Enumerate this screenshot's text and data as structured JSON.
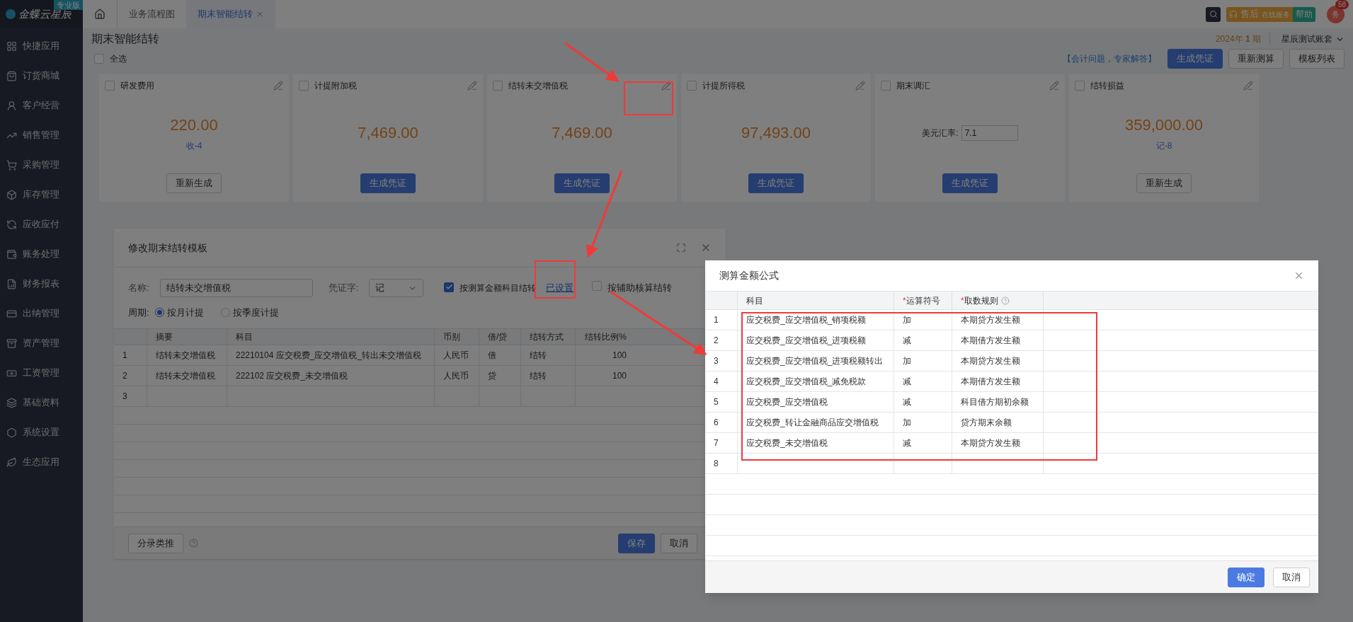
{
  "brand": {
    "name": "金蝶云星辰",
    "edition": "专业版"
  },
  "tabs": [
    {
      "label": "业务流程图",
      "selected": false,
      "closable": false
    },
    {
      "label": "期末智能结转",
      "selected": true,
      "closable": true
    }
  ],
  "header_right": {
    "service_main": "售后",
    "service_sub": "在线服务",
    "help": "帮助",
    "avatar": "务",
    "badge": "58"
  },
  "sidebar": {
    "items": [
      {
        "label": "快捷应用"
      },
      {
        "label": "订货商城"
      },
      {
        "label": "客户经营"
      },
      {
        "label": "销售管理"
      },
      {
        "label": "采购管理"
      },
      {
        "label": "库存管理"
      },
      {
        "label": "应收应付"
      },
      {
        "label": "账务处理"
      },
      {
        "label": "财务报表"
      },
      {
        "label": "出纳管理"
      },
      {
        "label": "资产管理"
      },
      {
        "label": "工资管理"
      },
      {
        "label": "基础资料"
      },
      {
        "label": "系统设置"
      },
      {
        "label": "生态应用"
      }
    ]
  },
  "page": {
    "title": "期末智能结转",
    "select_all": {
      "label": "全选",
      "checked": false
    },
    "period": "2024年 **1** 期",
    "account_set": "星辰测试账套",
    "expert_link": "【会计问题，专家解答】",
    "actions": [
      {
        "label": "生成凭证",
        "primary": true
      },
      {
        "label": "重新测算",
        "primary": false
      },
      {
        "label": "模板列表",
        "primary": false
      }
    ]
  },
  "cards": [
    {
      "title": "研发费用",
      "checked": false,
      "kind": "amount",
      "amount": "220.00",
      "note": "收-4",
      "button": {
        "label": "重新生成",
        "primary": false
      }
    },
    {
      "title": "计提附加税",
      "checked": false,
      "kind": "amount",
      "amount": "7,469.00",
      "button": {
        "label": "生成凭证",
        "primary": true
      }
    },
    {
      "title": "结转未交增值税",
      "checked": false,
      "kind": "amount",
      "amount": "7,469.00",
      "button": {
        "label": "生成凭证",
        "primary": true
      }
    },
    {
      "title": "计提所得税",
      "checked": false,
      "kind": "amount",
      "amount": "97,493.00",
      "button": {
        "label": "生成凭证",
        "primary": true
      }
    },
    {
      "title": "期末调汇",
      "checked": false,
      "kind": "rate",
      "rate_label": "美元汇率:",
      "rate_value": "7.1",
      "button": {
        "label": "生成凭证",
        "primary": true
      }
    },
    {
      "title": "结转损益",
      "checked": false,
      "kind": "amount",
      "amount": "359,000.00",
      "note": "记-8",
      "button": {
        "label": "重新生成",
        "primary": false
      }
    }
  ],
  "template_dialog": {
    "title": "修改期末结转模板",
    "name_label": "名称:",
    "name_value": "结转未交增值税",
    "voucher_label": "凭证字:",
    "voucher_value": "记",
    "by_measure": {
      "label": "按测算金额科目结转",
      "checked": true
    },
    "configured_link": "已设置",
    "by_aux": {
      "label": "按辅助核算结转",
      "checked": false
    },
    "period_label": "周期:",
    "periods": [
      {
        "label": "按月计提",
        "selected": true
      },
      {
        "label": "按季度计提",
        "selected": false
      }
    ],
    "columns": [
      "摘要",
      "科目",
      "币别",
      "借/贷",
      "结转方式",
      "结转比例%"
    ],
    "rows": [
      {
        "index": "1",
        "cells": [
          "结转未交增值税",
          "22210104 应交税费_应交增值税_转出未交增值税",
          "人民币",
          "借",
          "结转",
          "100"
        ]
      },
      {
        "index": "2",
        "cells": [
          "结转未交增值税",
          "222102 应交税费_未交增值税",
          "人民币",
          "贷",
          "结转",
          "100"
        ]
      },
      {
        "index": "3",
        "cells": [
          "",
          "",
          "",
          "",
          "",
          ""
        ]
      }
    ],
    "infer_button": "分录类推",
    "save": "保存",
    "cancel": "取消"
  },
  "formula_dialog": {
    "title": "测算金额公式",
    "columns": [
      {
        "label": "科目",
        "help": false
      },
      {
        "mark": "*",
        "label": "运算符号",
        "help": false
      },
      {
        "mark": "*",
        "label": "取数规则",
        "help": true
      }
    ],
    "rows": [
      {
        "index": "1",
        "cells": [
          "应交税费_应交增值税_销项税额",
          "加",
          "本期贷方发生额"
        ]
      },
      {
        "index": "2",
        "cells": [
          "应交税费_应交增值税_进项税额",
          "减",
          "本期借方发生额"
        ]
      },
      {
        "index": "3",
        "cells": [
          "应交税费_应交增值税_进项税额转出",
          "加",
          "本期贷方发生额"
        ]
      },
      {
        "index": "4",
        "cells": [
          "应交税费_应交增值税_减免税款",
          "减",
          "本期借方发生额"
        ]
      },
      {
        "index": "5",
        "cells": [
          "应交税费_应交增值税",
          "减",
          "科目借方期初余额"
        ]
      },
      {
        "index": "6",
        "cells": [
          "应交税费_转让金融商品应交增值税",
          "加",
          "贷方期末余额"
        ]
      },
      {
        "index": "7",
        "cells": [
          "应交税费_未交增值税",
          "减",
          "本期贷方发生额"
        ]
      },
      {
        "index": "8",
        "cells": [
          "",
          "",
          ""
        ]
      }
    ],
    "confirm": "确定",
    "cancel": "取消"
  }
}
